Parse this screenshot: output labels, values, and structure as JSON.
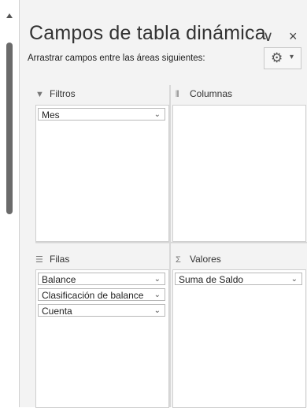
{
  "pane": {
    "title": "Campos de tabla dinámica",
    "subtitle": "Arrastrar campos entre las áreas siguientes:",
    "chevron_glyph": "∨",
    "close_glyph": "×"
  },
  "areas": {
    "filters": {
      "label": "Filtros",
      "fields": [
        "Mes"
      ]
    },
    "columns": {
      "label": "Columnas",
      "fields": []
    },
    "rows": {
      "label": "Filas",
      "fields": [
        "Balance",
        "Clasificación de balance",
        "Cuenta"
      ]
    },
    "values": {
      "label": "Valores",
      "fields": [
        "Suma de Saldo"
      ]
    }
  },
  "icons": {
    "filter": "filter-icon",
    "columns": "columns-icon",
    "rows": "rows-icon",
    "values": "sigma-icon",
    "gear": "gear-icon"
  },
  "colors": {
    "pane_bg": "#f3f3f3",
    "box_bg": "#ffffff",
    "scroll_thumb": "#6b6b6b"
  }
}
